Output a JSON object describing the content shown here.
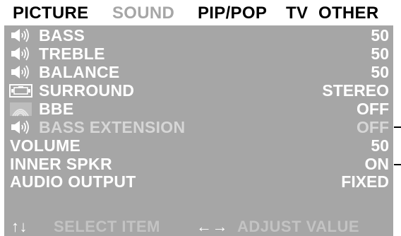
{
  "tabs": [
    {
      "label": "PICTURE"
    },
    {
      "label": "SOUND"
    },
    {
      "label": "PIP/POP"
    },
    {
      "label": "TV"
    },
    {
      "label": "OTHER"
    }
  ],
  "selected_tab": "SOUND",
  "menu": [
    {
      "label": "BASS",
      "value": "50",
      "icon": "speaker-icon"
    },
    {
      "label": "TREBLE",
      "value": "50",
      "icon": "speaker-icon"
    },
    {
      "label": "BALANCE",
      "value": "50",
      "icon": "speaker-icon"
    },
    {
      "label": "SURROUND",
      "value": "STEREO",
      "icon": "surround-icon"
    },
    {
      "label": "BBE",
      "value": "OFF",
      "icon": "bbe-icon"
    },
    {
      "label": "BASS EXTENSION",
      "value": "OFF",
      "icon": "speaker-icon"
    },
    {
      "label": "VOLUME",
      "value": "50"
    },
    {
      "label": "INNER  SPKR",
      "value": "ON"
    },
    {
      "label": "AUDIO  OUTPUT",
      "value": "FIXED"
    }
  ],
  "footer": {
    "select_arrows": "↑↓",
    "select_text": "SELECT ITEM",
    "adjust_arrows": "←→",
    "adjust_text": "ADJUST VALUE"
  },
  "colors": {
    "panel": "#a6a6a6",
    "text": "#ffffff",
    "selected_tab": "#a6a6a6",
    "tab_text": "#000000"
  }
}
